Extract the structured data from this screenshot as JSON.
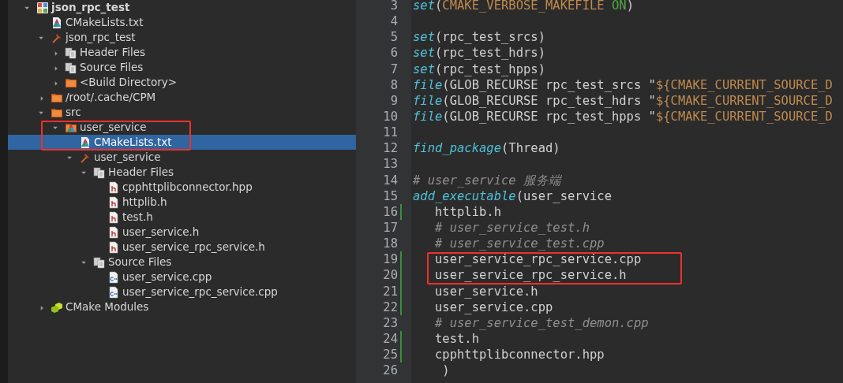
{
  "tree": [
    {
      "label": "json_rpc_test",
      "kind": "project",
      "expanded": true,
      "selected": false,
      "boxed": false,
      "children": [
        {
          "label": "CMakeLists.txt",
          "kind": "cmake",
          "selected": false,
          "boxed": false
        },
        {
          "label": "json_rpc_test",
          "kind": "target",
          "expanded": true,
          "selected": false,
          "boxed": false,
          "children": [
            {
              "label": "Header Files",
              "kind": "group",
              "expanded": false,
              "selected": false,
              "boxed": false
            },
            {
              "label": "Source Files",
              "kind": "group",
              "expanded": false,
              "selected": false,
              "boxed": false
            },
            {
              "label": "<Build Directory>",
              "kind": "folder",
              "expanded": false,
              "selected": false,
              "boxed": false
            }
          ]
        },
        {
          "label": "/root/.cache/CPM",
          "kind": "folder",
          "expanded": false,
          "selected": false,
          "boxed": false
        },
        {
          "label": "src",
          "kind": "folder",
          "expanded": true,
          "selected": false,
          "boxed": false,
          "children": [
            {
              "label": "user_service",
              "kind": "cmake-folder",
              "expanded": true,
              "selected": false,
              "boxed": true,
              "children": [
                {
                  "label": "CMakeLists.txt",
                  "kind": "cmake",
                  "selected": true,
                  "boxed": true
                },
                {
                  "label": "user_service",
                  "kind": "target",
                  "expanded": true,
                  "selected": false,
                  "boxed": false,
                  "children": [
                    {
                      "label": "Header Files",
                      "kind": "group",
                      "expanded": true,
                      "selected": false,
                      "boxed": false,
                      "children": [
                        {
                          "label": "cpphttplibconnector.hpp",
                          "kind": "header",
                          "selected": false,
                          "boxed": false
                        },
                        {
                          "label": "httplib.h",
                          "kind": "header",
                          "selected": false,
                          "boxed": false
                        },
                        {
                          "label": "test.h",
                          "kind": "header",
                          "selected": false,
                          "boxed": false
                        },
                        {
                          "label": "user_service.h",
                          "kind": "header",
                          "selected": false,
                          "boxed": false
                        },
                        {
                          "label": "user_service_rpc_service.h",
                          "kind": "header",
                          "selected": false,
                          "boxed": false
                        }
                      ]
                    },
                    {
                      "label": "Source Files",
                      "kind": "group",
                      "expanded": true,
                      "selected": false,
                      "boxed": false,
                      "children": [
                        {
                          "label": "user_service.cpp",
                          "kind": "cpp",
                          "selected": false,
                          "boxed": false
                        },
                        {
                          "label": "user_service_rpc_service.cpp",
                          "kind": "cpp",
                          "selected": false,
                          "boxed": false
                        }
                      ]
                    }
                  ]
                }
              ]
            }
          ]
        },
        {
          "label": "CMake Modules",
          "kind": "modules",
          "expanded": false,
          "selected": false,
          "boxed": false
        }
      ]
    }
  ],
  "editor": {
    "lines": [
      {
        "number": "3",
        "changed": false,
        "boxed": false,
        "tokens": [
          {
            "text": "set",
            "kind": "command"
          },
          {
            "text": "(",
            "kind": "plain"
          },
          {
            "text": "CMAKE_VERBOSE_MAKEFILE ",
            "kind": "variable"
          },
          {
            "text": "ON",
            "kind": "constant"
          },
          {
            "text": ")",
            "kind": "plain"
          }
        ]
      },
      {
        "number": "4",
        "changed": false,
        "boxed": false
      },
      {
        "number": "5",
        "changed": false,
        "boxed": false,
        "tokens": [
          {
            "text": "set",
            "kind": "command"
          },
          {
            "text": "(rpc_test_srcs)",
            "kind": "plain"
          }
        ]
      },
      {
        "number": "6",
        "changed": false,
        "boxed": false,
        "tokens": [
          {
            "text": "set",
            "kind": "command"
          },
          {
            "text": "(rpc_test_hdrs)",
            "kind": "plain"
          }
        ]
      },
      {
        "number": "7",
        "changed": false,
        "boxed": false,
        "tokens": [
          {
            "text": "set",
            "kind": "command"
          },
          {
            "text": "(rpc_test_hpps)",
            "kind": "plain"
          }
        ]
      },
      {
        "number": "8",
        "changed": false,
        "boxed": false,
        "tokens": [
          {
            "text": "file",
            "kind": "command"
          },
          {
            "text": "(GLOB_RECURSE rpc_test_srcs \"",
            "kind": "plain"
          },
          {
            "text": "${CMAKE_CURRENT_SOURCE_D",
            "kind": "variable"
          }
        ]
      },
      {
        "number": "9",
        "changed": false,
        "boxed": false,
        "tokens": [
          {
            "text": "file",
            "kind": "command"
          },
          {
            "text": "(GLOB_RECURSE rpc_test_hdrs \"",
            "kind": "plain"
          },
          {
            "text": "${CMAKE_CURRENT_SOURCE_D",
            "kind": "variable"
          }
        ]
      },
      {
        "number": "10",
        "changed": false,
        "boxed": false,
        "tokens": [
          {
            "text": "file",
            "kind": "command"
          },
          {
            "text": "(GLOB_RECURSE rpc_test_hpps \"",
            "kind": "plain"
          },
          {
            "text": "${CMAKE_CURRENT_SOURCE_D",
            "kind": "variable"
          }
        ]
      },
      {
        "number": "11",
        "changed": false,
        "boxed": false
      },
      {
        "number": "12",
        "changed": false,
        "boxed": false,
        "tokens": [
          {
            "text": "find_package",
            "kind": "command"
          },
          {
            "text": "(Thread)",
            "kind": "plain"
          }
        ]
      },
      {
        "number": "13",
        "changed": false,
        "boxed": false
      },
      {
        "number": "14",
        "changed": false,
        "boxed": false,
        "tokens": [
          {
            "text": "# user_service 服务端",
            "kind": "comment"
          }
        ]
      },
      {
        "number": "15",
        "changed": false,
        "boxed": false,
        "tokens": [
          {
            "text": "add_executable",
            "kind": "command"
          },
          {
            "text": "(user_service",
            "kind": "plain"
          }
        ]
      },
      {
        "number": "16",
        "changed": true,
        "boxed": false,
        "tokens": [
          {
            "text": "   httplib.h",
            "kind": "plain"
          }
        ]
      },
      {
        "number": "17",
        "changed": false,
        "boxed": false,
        "tokens": [
          {
            "text": "   # user_service_test.h",
            "kind": "comment"
          }
        ]
      },
      {
        "number": "18",
        "changed": false,
        "boxed": false,
        "tokens": [
          {
            "text": "   # user_service_test.cpp",
            "kind": "comment"
          }
        ]
      },
      {
        "number": "19",
        "changed": true,
        "boxed": true,
        "tokens": [
          {
            "text": "   user_service_rpc_service.cpp",
            "kind": "plain"
          }
        ]
      },
      {
        "number": "20",
        "changed": true,
        "boxed": true,
        "tokens": [
          {
            "text": "   user_service_rpc_service.h",
            "kind": "plain"
          }
        ]
      },
      {
        "number": "21",
        "changed": true,
        "boxed": false,
        "tokens": [
          {
            "text": "   user_service.h",
            "kind": "plain"
          }
        ]
      },
      {
        "number": "22",
        "changed": true,
        "boxed": false,
        "tokens": [
          {
            "text": "   user_service.cpp",
            "kind": "plain"
          }
        ]
      },
      {
        "number": "23",
        "changed": false,
        "boxed": false,
        "tokens": [
          {
            "text": "   # user_service_test_demon.cpp",
            "kind": "comment"
          }
        ]
      },
      {
        "number": "24",
        "changed": true,
        "boxed": false,
        "tokens": [
          {
            "text": "   test.h",
            "kind": "plain"
          }
        ]
      },
      {
        "number": "25",
        "changed": true,
        "boxed": false,
        "tokens": [
          {
            "text": "   cpphttplibconnector.hpp",
            "kind": "plain"
          }
        ]
      },
      {
        "number": "26",
        "changed": false,
        "boxed": false,
        "tokens": [
          {
            "text": "    )",
            "kind": "plain"
          }
        ]
      }
    ]
  }
}
